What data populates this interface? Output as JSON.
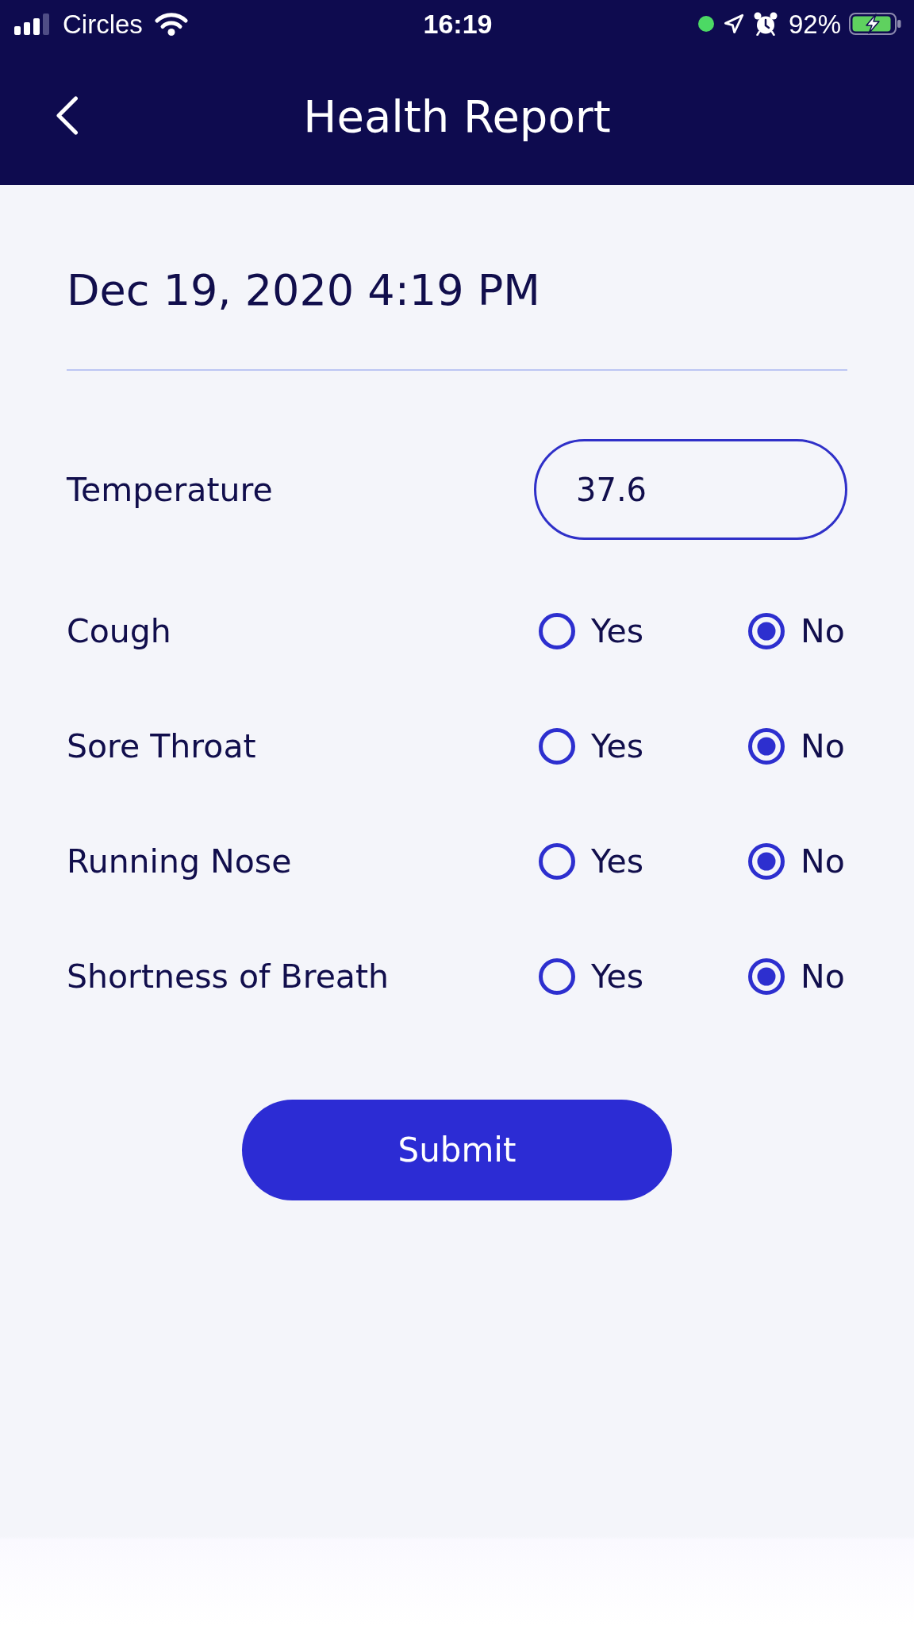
{
  "status_bar": {
    "carrier": "Circles",
    "time": "16:19",
    "battery": "92%"
  },
  "header": {
    "title": "Health Report"
  },
  "report": {
    "date": "Dec 19, 2020 4:19 PM"
  },
  "temperature": {
    "label": "Temperature",
    "value": "37.6"
  },
  "symptoms": [
    {
      "label": "Cough",
      "options": [
        {
          "label": "Yes",
          "selected": false
        },
        {
          "label": "No",
          "selected": true
        }
      ]
    },
    {
      "label": "Sore Throat",
      "options": [
        {
          "label": "Yes",
          "selected": false
        },
        {
          "label": "No",
          "selected": true
        }
      ]
    },
    {
      "label": "Running Nose",
      "options": [
        {
          "label": "Yes",
          "selected": false
        },
        {
          "label": "No",
          "selected": true
        }
      ]
    },
    {
      "label": "Shortness of Breath",
      "options": [
        {
          "label": "Yes",
          "selected": false
        },
        {
          "label": "No",
          "selected": true
        }
      ]
    }
  ],
  "submit": {
    "label": "Submit"
  }
}
